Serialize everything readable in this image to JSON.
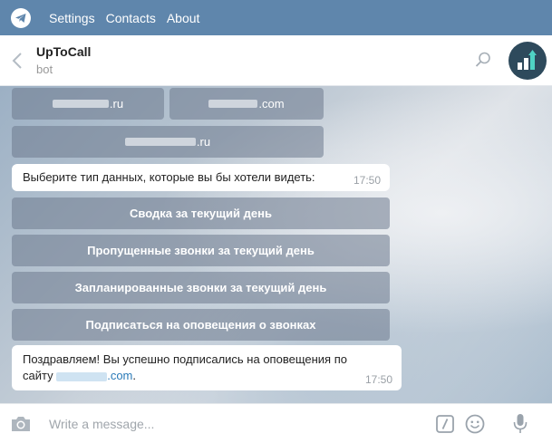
{
  "menu": {
    "items": [
      "Settings",
      "Contacts",
      "About"
    ]
  },
  "chat": {
    "title": "UpToCall",
    "subtitle": "bot"
  },
  "keyboard_top": {
    "domain1_suffix": ".ru",
    "domain2_suffix": ".com",
    "domain3_suffix": ".ru"
  },
  "messages": {
    "prompt": {
      "text": "Выберите тип данных, которые вы бы хотели видеть:",
      "time": "17:50"
    },
    "success": {
      "line1": "Поздравляем! Вы успешно подписались на оповещения по",
      "line2_prefix": "сайту",
      "link_suffix": ".com",
      "line2_end": ".",
      "time": "17:50"
    }
  },
  "keyboard": {
    "buttons": [
      "Сводка за текущий день",
      "Пропущенные звонки за текущий день",
      "Запланированные звонки за текущий день",
      "Подписаться на оповещения о звонках"
    ]
  },
  "composer": {
    "placeholder": "Write a message..."
  },
  "colors": {
    "menubar": "#5f86ac",
    "avatar": "#2e4a5c",
    "link": "#2a7ab8"
  }
}
